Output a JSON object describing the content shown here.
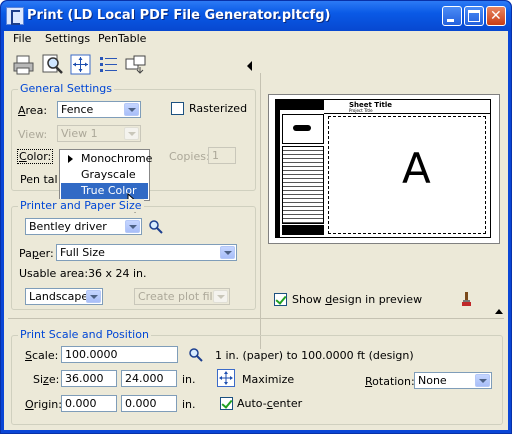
{
  "window": {
    "title": "Print  (LD Local PDF File Generator.pltcfg)"
  },
  "menubar": {
    "file": "File",
    "settings": "Settings",
    "pentable": "PenTable"
  },
  "general": {
    "group_label": "General Settings",
    "area_label": "Area:",
    "area_value": "Fence",
    "rasterized_label": "Rasterized",
    "view_label": "View:",
    "view_value": "View 1",
    "color_label": "Color:",
    "copies_label": "Copies:",
    "copies_value": "1",
    "pen_table_label": "Pen tal"
  },
  "color_menu": {
    "items": [
      "Monochrome",
      "Grayscale",
      "True Color"
    ],
    "highlighted": "True Color"
  },
  "printer": {
    "group_label": "Printer and Paper Size",
    "driver_value": "Bentley driver",
    "paper_label": "Paper:",
    "paper_value": "Full Size",
    "usable_area_label": "Usable area:",
    "usable_area_value": "36 x 24 in.",
    "orientation_value": "Landscape",
    "create_plot_file_value": "Create plot file"
  },
  "preview": {
    "sheet_title": "Sheet Title",
    "sheet_subtitle": "Project Title",
    "big_letter": "A",
    "show_design_label": "Show design in preview"
  },
  "scale": {
    "group_label": "Print Scale and Position",
    "scale_label": "Scale:",
    "scale_value": "100.0000",
    "scale_desc": "1 in. (paper) to 100.0000 ft (design)",
    "size_label": "Size:",
    "size_w": "36.000",
    "size_h": "24.000",
    "size_unit": "in.",
    "maximize_label": "Maximize",
    "rotation_label": "Rotation:",
    "rotation_value": "None",
    "origin_label": "Origin:",
    "origin_x": "0.000",
    "origin_y": "0.000",
    "origin_unit": "in.",
    "autocenter_label": "Auto-center"
  }
}
